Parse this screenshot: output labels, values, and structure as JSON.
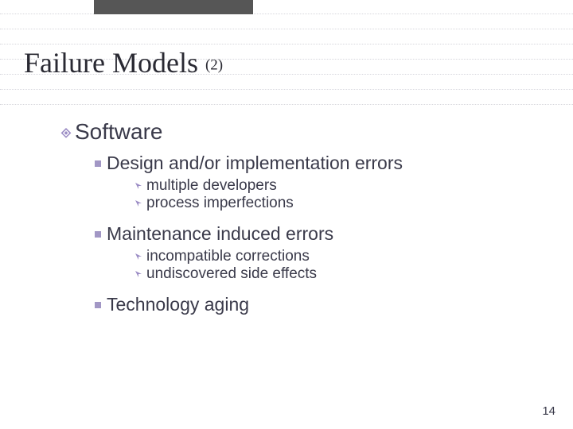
{
  "title": {
    "main": "Failure Models ",
    "sub": "(2)"
  },
  "body": [
    {
      "text": "Software",
      "children": [
        {
          "text": "Design and/or implementation errors",
          "children": [
            {
              "text": "multiple developers"
            },
            {
              "text": "process imperfections"
            }
          ]
        },
        {
          "text": "Maintenance induced errors",
          "children": [
            {
              "text": "incompatible corrections"
            },
            {
              "text": "undiscovered side effects"
            }
          ]
        },
        {
          "text": "Technology aging",
          "children": []
        }
      ]
    }
  ],
  "page_number": "14",
  "colors": {
    "accent": "#9a8bc4",
    "text": "#3a3a4a",
    "shadow": "#565656"
  }
}
